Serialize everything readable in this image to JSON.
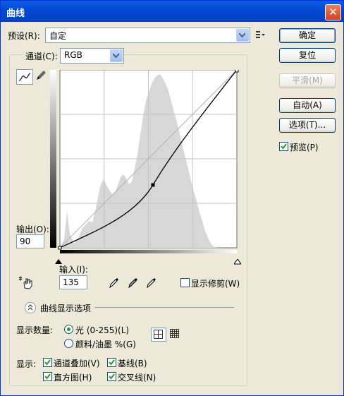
{
  "window": {
    "title": "曲线",
    "close_label": "✕"
  },
  "preset": {
    "label": "预设(R):",
    "value": "自定"
  },
  "channel": {
    "label": "通道(C):",
    "value": "RGB"
  },
  "buttons": {
    "ok": "确定",
    "reset": "复位",
    "smooth": "平滑(M)",
    "auto": "自动(A)",
    "options": "选项(T)..."
  },
  "preview": {
    "label": "预览(P)",
    "checked": true
  },
  "output": {
    "label": "输出(O):",
    "value": "90"
  },
  "input": {
    "label": "输入(I):",
    "value": "135"
  },
  "show_clipping": {
    "label": "显示修剪(W)",
    "checked": false
  },
  "curve_options": {
    "label": "曲线显示选项"
  },
  "show_amount": {
    "label": "显示数量:",
    "light": "光 (0-255)(L)",
    "pigment": "颜料/油墨 %(G)",
    "selected": "light"
  },
  "show": {
    "label": "显示:",
    "channel_overlay": "通道叠加(V)",
    "baseline": "基线(B)",
    "histogram": "直方图(H)",
    "intersection": "交叉线(N)"
  },
  "curve_point": {
    "input": 135,
    "output": 90
  },
  "icons": [
    "curve-tool-icon",
    "pencil-icon",
    "hand-adjust-icon",
    "black-eyedropper-icon",
    "gray-eyedropper-icon",
    "white-eyedropper-icon",
    "preset-menu-icon",
    "expand-icon",
    "grid-4-icon",
    "grid-10-icon"
  ]
}
